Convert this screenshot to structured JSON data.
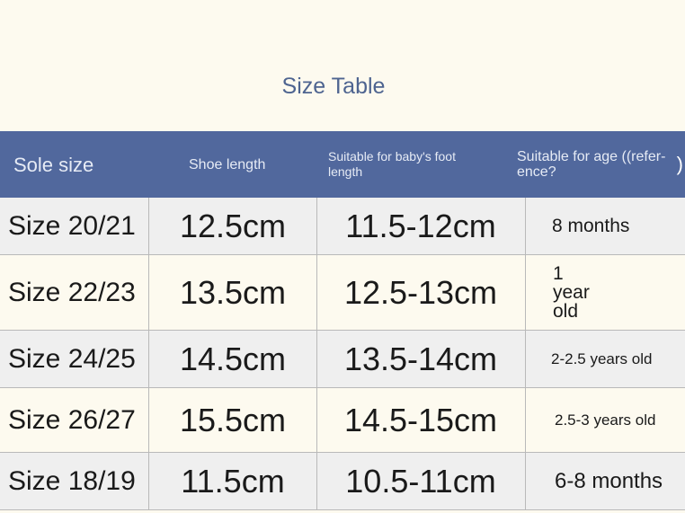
{
  "title": "Size Table",
  "headers": {
    "sole_size": "Sole size",
    "shoe_length": "Shoe length",
    "foot_length": "Suitable for baby's foot length",
    "age": "Suitable for age ((refer-ence?",
    "age_trailing": ")"
  },
  "rows": [
    {
      "size": "Size 20/21",
      "shoe_length": "12.5cm",
      "foot_length": "11.5-12cm",
      "age": "8 months"
    },
    {
      "size": "Size 22/23",
      "shoe_length": "13.5cm",
      "foot_length": "12.5-13cm",
      "age": "1 year old"
    },
    {
      "size": "Size 24/25",
      "shoe_length": "14.5cm",
      "foot_length": "13.5-14cm",
      "age": "2-2.5 years old"
    },
    {
      "size": "Size 26/27",
      "shoe_length": "15.5cm",
      "foot_length": "14.5-15cm",
      "age": "2.5-3 years old"
    },
    {
      "size": "Size 18/19",
      "shoe_length": "11.5cm",
      "foot_length": "10.5-11cm",
      "age": "6-8 months"
    }
  ]
}
